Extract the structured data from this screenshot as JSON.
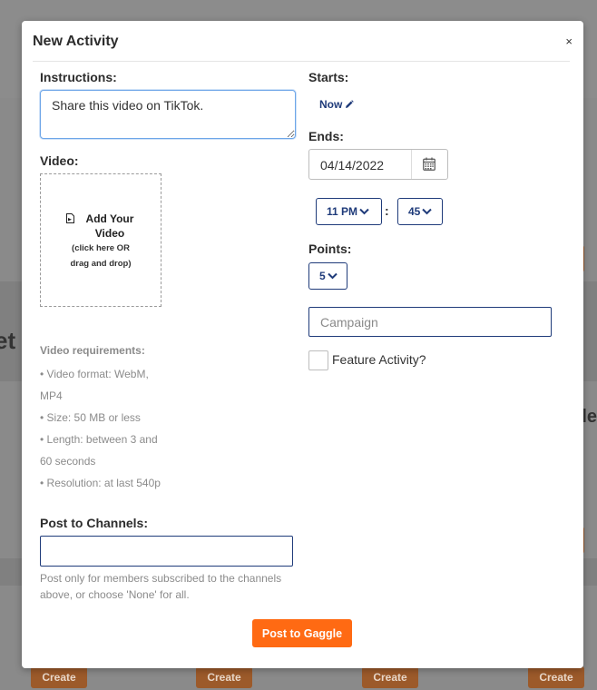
{
  "background": {
    "partial_heading": "et",
    "partial_side_text": "le",
    "create_buttons": [
      "Create",
      "Create",
      "Create",
      "Create"
    ]
  },
  "modal": {
    "title": "New Activity",
    "close_symbol": "×"
  },
  "instructions": {
    "label": "Instructions:",
    "value": "Share this video on TikTok."
  },
  "video": {
    "label": "Video:",
    "dropzone_title_line1": "Add Your",
    "dropzone_title_line2": "Video",
    "dropzone_sub_line1": "(click here OR",
    "dropzone_sub_line2": "drag and drop)",
    "file_icon": "file-video-icon"
  },
  "requirements": {
    "title": "Video requirements:",
    "items": [
      "• Video format: WebM,",
      "MP4",
      "• Size: 50 MB or less",
      "• Length: between 3 and",
      "60 seconds",
      "• Resolution: at last 540p"
    ]
  },
  "channels": {
    "label": "Post to Channels:",
    "value": "",
    "hint": "Post only for members subscribed to the channels above, or choose 'None' for all."
  },
  "submit": {
    "label": "Post to Gaggle",
    "color": "#ff6a13"
  },
  "starts": {
    "label": "Starts:",
    "value": "Now",
    "edit_icon": "pencil-icon"
  },
  "ends": {
    "label": "Ends:",
    "date": "04/14/2022",
    "calendar_icon": "calendar-icon",
    "hour": "11 PM",
    "colon": ":",
    "minute": "45"
  },
  "points": {
    "label": "Points:",
    "value": "5"
  },
  "campaign": {
    "placeholder": "Campaign",
    "value": ""
  },
  "feature": {
    "label": "Feature Activity?",
    "checked": false
  },
  "colors": {
    "accent_navy": "#1f3b7a",
    "focus_blue": "#6ea6e8"
  }
}
